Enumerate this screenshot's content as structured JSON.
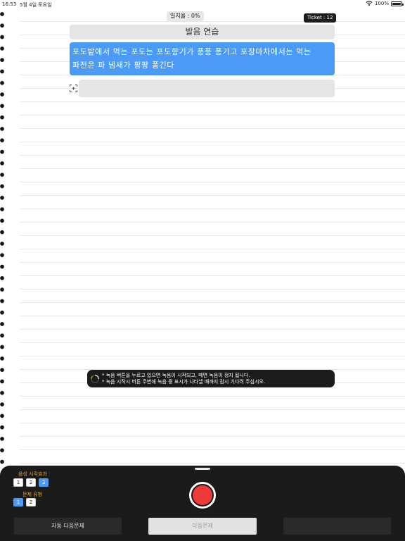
{
  "status": {
    "time": "16:53",
    "date": "5월 4일 토요일",
    "battery": "100%"
  },
  "header": {
    "match_rate": "일치율 : 0%",
    "ticket": "Ticket : 12"
  },
  "practice": {
    "title": "발음 연습",
    "sentence_line1": "포도밭에서 먹는 포도는 포도향기가 풍풍 풍기고 포장마차에서는 먹는",
    "sentence_line2": "파전은 파 냄새가 팡팡 퐁긴다",
    "recognized_text": ""
  },
  "hint": {
    "line1": "* 녹음 버튼을 누르고 있으면 녹음이 시작되고, 떼면 녹음이 정지 됩니다.",
    "line2": "* 녹음 시작시 버튼 주변에 녹음 중 표시가 나타낼 때까지 잠시 기다려 주십시오."
  },
  "bottom": {
    "voice_effect_label": "음성 시각효과",
    "voice_effect_options": [
      "1",
      "2",
      "3"
    ],
    "voice_effect_selected": "3",
    "question_type_label": "문제 유형",
    "question_type_options": [
      "1",
      "2"
    ],
    "question_type_selected": "1",
    "auto_next_label": "자동 다음문제",
    "next_label": "다음문제",
    "extra_label": ""
  },
  "colors": {
    "accent": "#4a9af6",
    "record": "#f03a3a",
    "panel": "#1b1b1b",
    "option_label": "#e8a330"
  }
}
